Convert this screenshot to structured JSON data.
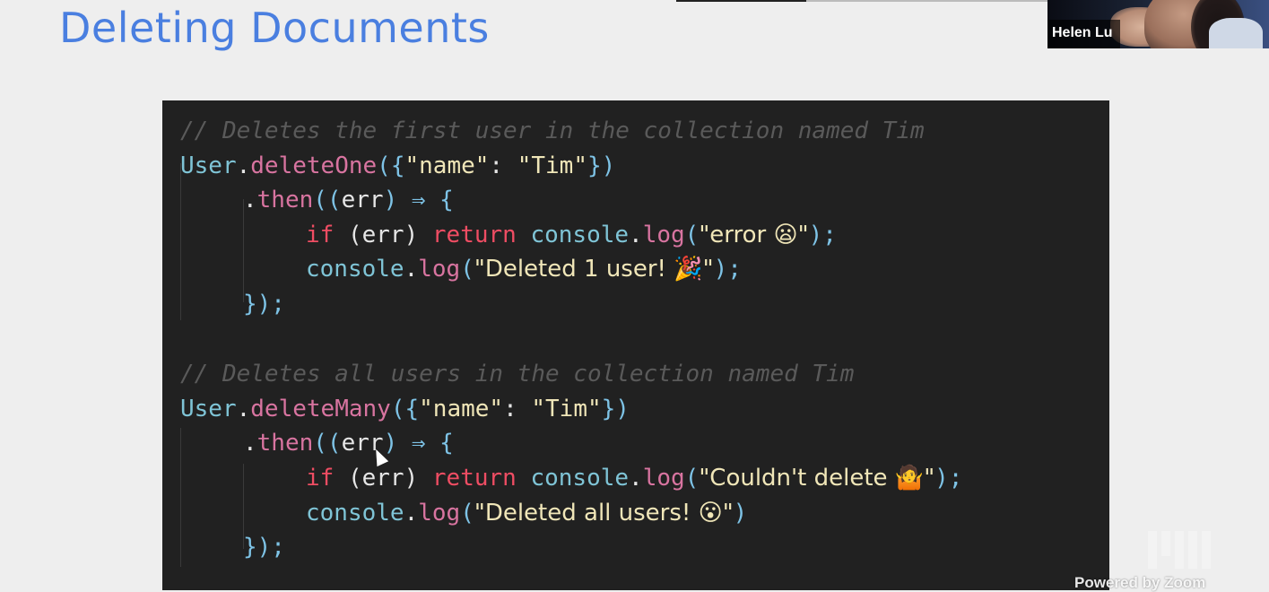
{
  "slide": {
    "title": "Deleting Documents"
  },
  "participant": {
    "name": "Helen Lu"
  },
  "code": {
    "block1": {
      "comment": "// Deletes the first user in the collection named Tim",
      "call_obj": "User",
      "call_dot": ".",
      "call_fn": "deleteOne",
      "call_open": "({",
      "key": "\"name\"",
      "colon": ": ",
      "value": "\"Tim\"",
      "call_close": "})",
      "then_dot": ".",
      "then_fn": "then",
      "then_open": "((",
      "then_arg": "err",
      "then_arrow": ") ⇒ {",
      "if_kw": "if",
      "if_cond": " (err) ",
      "return_kw": "return",
      "log_obj": " console",
      "log_dot": ".",
      "log_fn": "log",
      "log_open": "(",
      "err_msg": "\"error 😦\"",
      "log_close": ");",
      "log2_obj": "console",
      "log2_fn": "log",
      "success_msg": "\"Deleted 1 user! 🎉\"",
      "end": "});"
    },
    "block2": {
      "comment": "// Deletes all users in the collection named Tim",
      "call_obj": "User",
      "call_dot": ".",
      "call_fn": "deleteMany",
      "call_open": "({",
      "key": "\"name\"",
      "colon": ": ",
      "value": "\"Tim\"",
      "call_close": "})",
      "then_dot": ".",
      "then_fn": "then",
      "then_open": "((",
      "then_arg": "err",
      "then_arrow": ") ⇒ {",
      "if_kw": "if",
      "if_cond": " (err) ",
      "return_kw": "return",
      "log_obj": " console",
      "log_dot": ".",
      "log_fn": "log",
      "log_open": "(",
      "err_msg": "\"Couldn't delete 🤷\"",
      "log_close": ");",
      "log2_obj": "console",
      "log2_fn": "log",
      "success_msg": "\"Deleted all users! 😮\"",
      "log2_close": ")",
      "end": "});"
    }
  },
  "footer": {
    "powered_by": "Powered by Zoom"
  },
  "colors": {
    "title": "#4a7fe0",
    "code_bg": "#212121",
    "comment": "#5a5a5a",
    "object": "#7fc4d6",
    "function": "#d874a0",
    "string": "#f0e6b8",
    "keyword": "#ef4d63"
  }
}
